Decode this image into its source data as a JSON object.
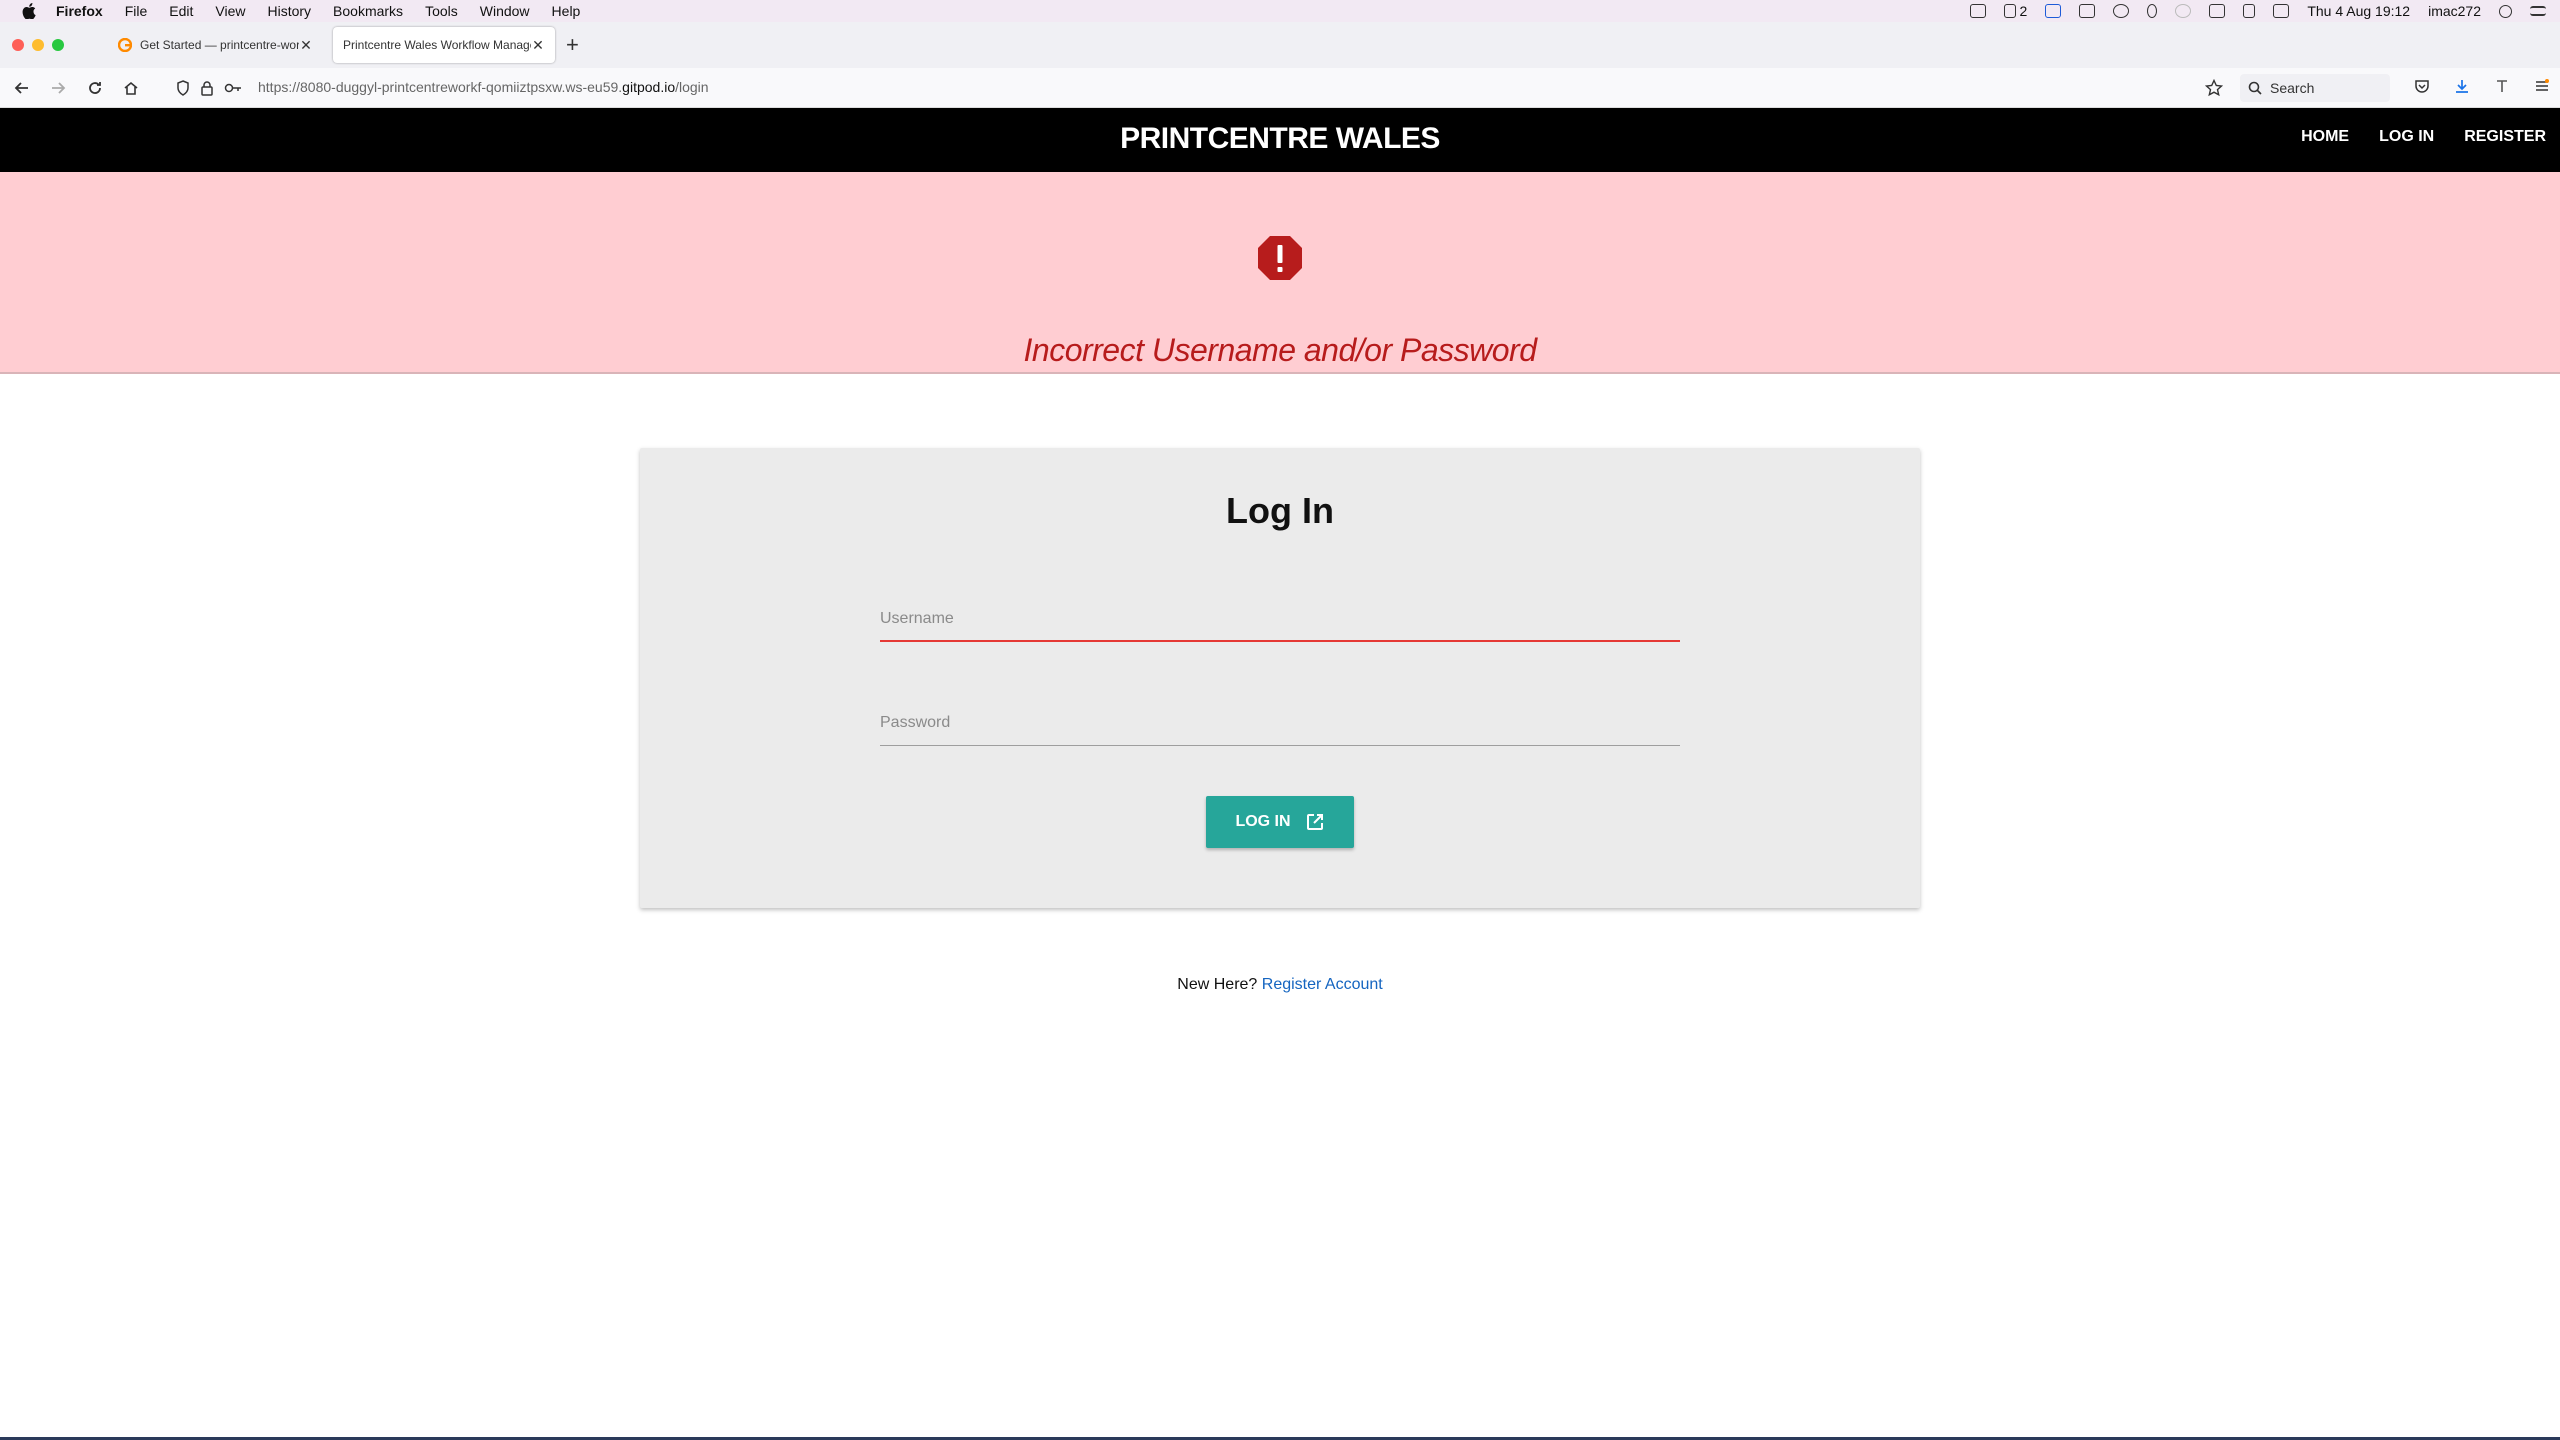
{
  "os_menubar": {
    "app_name": "Firefox",
    "menus": [
      "File",
      "Edit",
      "View",
      "History",
      "Bookmarks",
      "Tools",
      "Window",
      "Help"
    ],
    "status_badge_text": "2",
    "clock": "Thu 4 Aug  19:12",
    "username": "imac272"
  },
  "browser": {
    "tabs": [
      {
        "title": "Get Started — printcentre-workf",
        "active": false
      },
      {
        "title": "Printcentre Wales Workflow Manage",
        "active": true
      }
    ],
    "url_prefix": "https://8080-duggyl-printcentreworkf-qomiiztpsxw.ws-eu59.",
    "url_domain": "gitpod.io",
    "url_path": "/login",
    "search_placeholder": "Search"
  },
  "site": {
    "brand": "PRINTCENTRE WALES",
    "nav": [
      "HOME",
      "LOG IN",
      "REGISTER"
    ]
  },
  "alert": {
    "message": "Incorrect Username and/or Password",
    "icon": "exclamation-octagon-icon",
    "color": "#b71c1c",
    "background": "#ffcdd2"
  },
  "login_card": {
    "title": "Log In",
    "username_label": "Username",
    "password_label": "Password",
    "button_label": "LOG IN",
    "button_icon": "open-in-new-icon",
    "button_color": "#26a69a"
  },
  "footer_prompt": {
    "text": "New Here?",
    "link": "Register Account"
  }
}
